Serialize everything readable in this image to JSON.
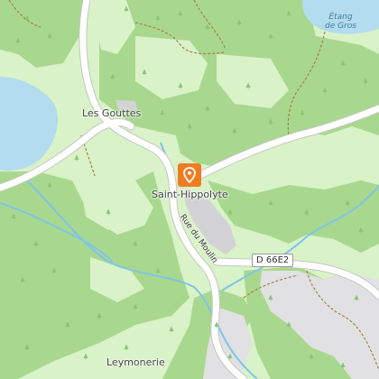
{
  "map": {
    "places": {
      "les_gouttes": "Les Gouttes",
      "saint_hippolyte": "Saint-Hippolyte",
      "leymonerie": "Leymonerie"
    },
    "water": {
      "etang_de_gros_line1": "Étang",
      "etang_de_gros_line2": "de Gros"
    },
    "roads": {
      "d66e2": "D 66E2",
      "rue_du_moulin": "Rue du Moulin"
    },
    "marker": {
      "icon": "location-pin-icon",
      "color": "#f07c22"
    },
    "colors": {
      "meadow": "#d9f2c8",
      "forest": "#a8d88e",
      "water": "#b3dcee",
      "stream": "#7fc4e8",
      "road": "#ffffff",
      "built_area": "#d3d3d6",
      "path": "#a5763f"
    }
  }
}
